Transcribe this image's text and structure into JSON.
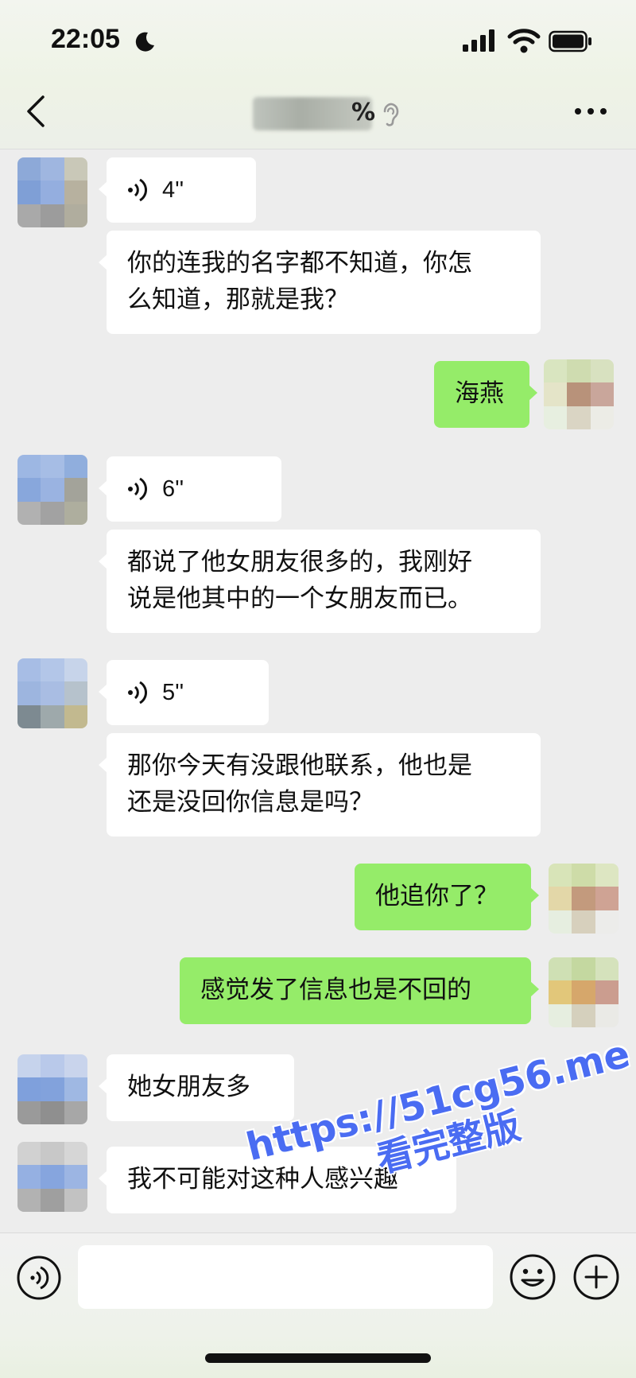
{
  "status_bar": {
    "time": "22:05",
    "icons": [
      "moon-icon",
      "signal-icon",
      "wifi-icon",
      "battery-icon"
    ]
  },
  "header": {
    "title_visible_tail": "%",
    "icons": [
      "back-icon",
      "ear-icon",
      "more-icon"
    ]
  },
  "messages": [
    {
      "side": "left",
      "type": "voice",
      "duration": "4''"
    },
    {
      "side": "left",
      "type": "text",
      "lines": [
        "你的连我的名字都不知道，你怎",
        "么知道，那就是我？"
      ]
    },
    {
      "side": "right",
      "type": "text",
      "lines": [
        "海燕"
      ]
    },
    {
      "side": "left",
      "type": "voice",
      "duration": "6''"
    },
    {
      "side": "left",
      "type": "text",
      "lines": [
        "都说了他女朋友很多的，我刚好",
        "说是他其中的一个女朋友而已。"
      ]
    },
    {
      "side": "left",
      "type": "voice",
      "duration": "5''"
    },
    {
      "side": "left",
      "type": "text",
      "lines": [
        "那你今天有没跟他联系，他也是",
        "还是没回你信息是吗？"
      ]
    },
    {
      "side": "right",
      "type": "text",
      "lines": [
        "他追你了？"
      ]
    },
    {
      "side": "right",
      "type": "text",
      "lines": [
        "感觉发了信息也是不回的"
      ]
    },
    {
      "side": "left",
      "type": "text",
      "lines": [
        "她女朋友多"
      ]
    },
    {
      "side": "left",
      "type": "text",
      "lines": [
        "我不可能对这种人感兴趣"
      ]
    }
  ],
  "input_bar": {
    "input_value": "",
    "icons": [
      "voice-toggle-icon",
      "emoji-icon",
      "plus-icon"
    ]
  },
  "watermark": {
    "line1": "https://51cg56.me",
    "line2": "看完整版"
  },
  "colors": {
    "background": "#ededed",
    "my_bubble": "#95ec69",
    "other_bubble": "#ffffff",
    "watermark": "#4a6cf2"
  }
}
